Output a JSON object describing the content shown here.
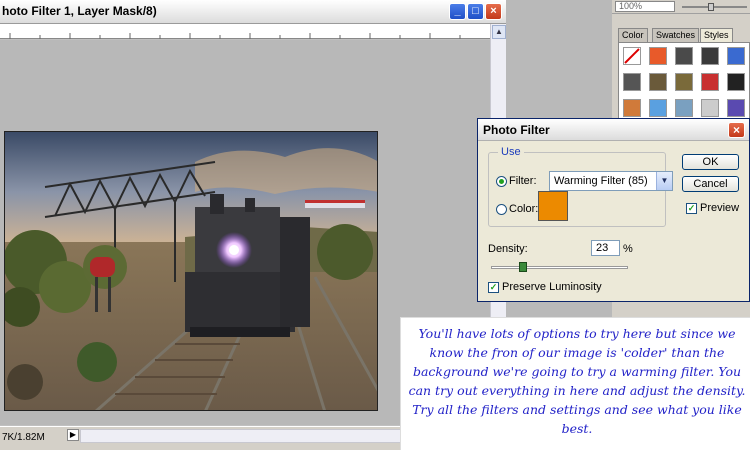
{
  "document": {
    "title": "hoto Filter 1, Layer Mask/8)",
    "status_text": "7K/1.82M",
    "window_buttons": [
      "_",
      "□",
      "×"
    ]
  },
  "panel": {
    "zoom_value": "100%",
    "tabs": [
      "Color",
      "Swatches",
      "Styles"
    ],
    "active_tab": "Styles",
    "style_swatch_colors": [
      "#ffffff",
      "#e85a2a",
      "#4a4a4a",
      "#3a3a3a",
      "#3a6ad0",
      "#555555",
      "#6a5a3a",
      "#7a6a3a",
      "#c83030",
      "#222222",
      "#d07a3a",
      "#5aa0e0",
      "#7aa0c0",
      "#cccccc",
      "#5a4ab0"
    ]
  },
  "dialog": {
    "title": "Photo Filter",
    "group_label": "Use",
    "filter_label": "Filter:",
    "filter_value": "Warming Filter (85)",
    "color_label": "Color:",
    "color_value": "#ec8a00",
    "ok_label": "OK",
    "cancel_label": "Cancel",
    "preview_label": "Preview",
    "preview_checked": true,
    "density_label": "Density:",
    "density_value": "23",
    "density_unit": "%",
    "density_fraction": 0.23,
    "preserve_label": "Preserve Luminosity",
    "preserve_checked": true,
    "selected_option": "filter"
  },
  "note": {
    "text": "You'll have lots of options to try here but since we know the fron of our image is 'colder' than the background we're going to try a warming filter. You can try out everything in here and adjust the density. Try all the filters and settings and see what you like best."
  }
}
